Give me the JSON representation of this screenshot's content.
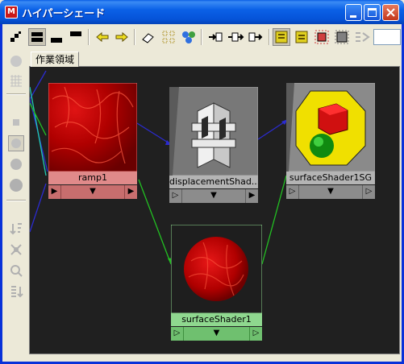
{
  "window": {
    "title": "ハイパーシェード",
    "app_icon_glyph": "M",
    "controls": [
      "minimize-icon",
      "maximize-icon",
      "close-icon"
    ]
  },
  "toolbar": {
    "buttons": [
      "layout-icon",
      "show-top-tabs-icon",
      "show-bottom-tabs-icon",
      "show-top-and-bottom-tabs-icon",
      "previous-graph-icon",
      "next-graph-icon",
      "clear-graph-icon",
      "rearrange-graph-icon",
      "graph-materials-icon",
      "input-connections-icon",
      "input-output-connections-icon",
      "output-connections-icon",
      "swatch-display-icon",
      "node-display-icon",
      "hide-unselected-icon",
      "show-swatches-icon",
      "extra-toggle-icon"
    ]
  },
  "tab": {
    "label": "作業領域"
  },
  "nodes": [
    {
      "id": "ramp",
      "label": "ramp1",
      "ports": [
        "▶",
        "▼",
        "▶"
      ],
      "colors": {
        "header": "#e08a8a",
        "ports": "#c86e6e",
        "swatch": "#b00000"
      }
    },
    {
      "id": "displacement",
      "label": "displacementShad...",
      "ports": [
        "▷",
        "▼",
        "▶"
      ],
      "colors": {
        "header": "#b4b4b4",
        "ports": "#8c8c8c",
        "swatch": "#7a7a7a"
      }
    },
    {
      "id": "sg",
      "label": "surfaceShader1SG",
      "ports": [
        "▷",
        "▼",
        "▷"
      ],
      "colors": {
        "header": "#b4b4b4",
        "ports": "#8c8c8c",
        "swatch": "#8c8c8c"
      }
    },
    {
      "id": "surfaceShader",
      "label": "surfaceShader1",
      "ports": [
        "▷",
        "▼",
        "▷"
      ],
      "colors": {
        "header": "#8fd88f",
        "ports": "#6fc06f",
        "swatch": "#1e1e1e"
      }
    }
  ],
  "colors": {
    "graph_bg": "#202020",
    "wire_blue": "#2b2bd0",
    "wire_green": "#22c022",
    "wire_cyan": "#20c8b0"
  }
}
